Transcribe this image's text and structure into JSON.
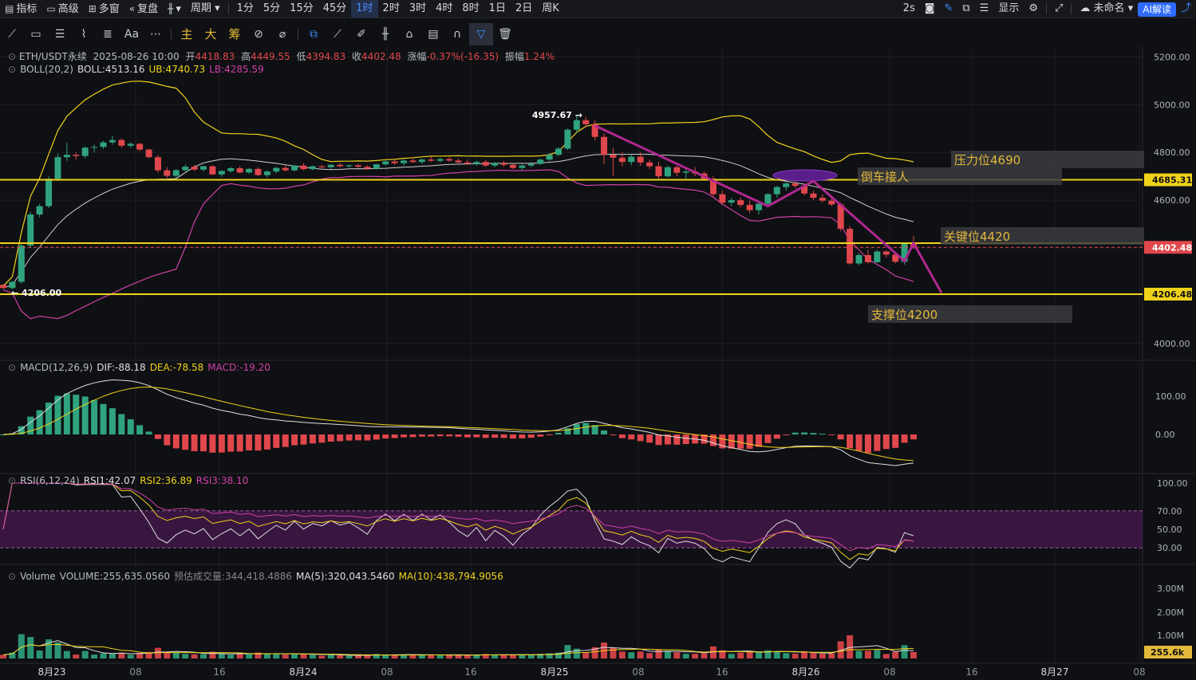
{
  "topbar": {
    "indicator": "指标",
    "advanced": "高级",
    "multi": "多窗",
    "replay": "复盘",
    "period_label": "周期",
    "periods": [
      "1分",
      "5分",
      "15分",
      "45分",
      "1时",
      "2时",
      "3时",
      "4时",
      "8时",
      "1日",
      "2日",
      "周K"
    ],
    "active_period": "1时",
    "refresh": "2s",
    "display": "显示",
    "unnamed": "未命名",
    "ai": "AI解读"
  },
  "toolbar": {
    "main": "主",
    "big": "大",
    "chip": "筹",
    "text_tool": "Aa"
  },
  "header": {
    "symbol": "ETH/USDT永续",
    "datetime": "2025-08-26 10:00",
    "open_label": "开",
    "open": "4418.83",
    "high_label": "高",
    "high": "4449.55",
    "low_label": "低",
    "low": "4394.83",
    "close_label": "收",
    "close": "4402.48",
    "change_label": "涨幅",
    "change": "-0.37%(-16.35)",
    "amp_label": "振幅",
    "amp": "1.24%"
  },
  "boll": {
    "name": "BOLL(20,2)",
    "mid": "BOLL:4513.16",
    "ub": "UB:4740.73",
    "lb": "LB:4285.59"
  },
  "macd": {
    "name": "MACD(12,26,9)",
    "dif": "DIF:-88.18",
    "dea": "DEA:-78.58",
    "macd": "MACD:-19.20"
  },
  "rsi": {
    "name": "RSI(6,12,24)",
    "r1": "RSI1:42.07",
    "r2": "RSI2:36.89",
    "r3": "RSI3:38.10"
  },
  "vol": {
    "name": "Volume",
    "vol": "VOLUME:255,635.0560",
    "pred": "预估成交量:344,418.4886",
    "ma5": "MA(5):320,043.5460",
    "ma10": "MA(10):438,794.9056"
  },
  "annotations": {
    "resistance": "压力位4690",
    "pullback": "倒车接人",
    "key": "关键位4420",
    "support": "支撑位4200",
    "high_mark": "4957.67",
    "low_mark": "4206.00"
  },
  "colors": {
    "up": "#2fa37e",
    "down": "#e0474c",
    "yellow": "#f0d21a",
    "purple": "#b0288f",
    "bg": "#0f1013"
  },
  "chart_data": {
    "type": "candlestick",
    "symbol": "ETH/USDT",
    "interval": "1h",
    "price_axis": {
      "ticks": [
        4000,
        4200,
        4400,
        4600,
        4800,
        5000,
        5200
      ],
      "tick_labels": [
        "4000.00",
        "4200.00",
        "4400.00",
        "4600.00",
        "4800.00",
        "5000.00",
        "5200.00"
      ]
    },
    "price_tags": {
      "resistance_line": "4685.31",
      "last": "4402.48",
      "support_line": "4206.48"
    },
    "horizontal_lines": [
      4685.31,
      4420,
      4206.48
    ],
    "x_ticks": [
      "8月23",
      "08",
      "16",
      "8月24",
      "08",
      "16",
      "8月25",
      "08",
      "16",
      "8月26",
      "08",
      "16",
      "8月27",
      "08"
    ],
    "candles": [
      [
        4245,
        4248,
        4230,
        4232
      ],
      [
        4232,
        4262,
        4226,
        4258
      ],
      [
        4258,
        4420,
        4250,
        4410
      ],
      [
        4410,
        4552,
        4400,
        4540
      ],
      [
        4540,
        4585,
        4528,
        4575
      ],
      [
        4575,
        4700,
        4566,
        4690
      ],
      [
        4690,
        4795,
        4680,
        4780
      ],
      [
        4780,
        4840,
        4765,
        4790
      ],
      [
        4790,
        4800,
        4770,
        4785
      ],
      [
        4785,
        4825,
        4775,
        4820
      ],
      [
        4820,
        4832,
        4800,
        4823
      ],
      [
        4823,
        4848,
        4815,
        4842
      ],
      [
        4842,
        4870,
        4832,
        4852
      ],
      [
        4852,
        4858,
        4820,
        4828
      ],
      [
        4828,
        4842,
        4818,
        4836
      ],
      [
        4836,
        4840,
        4805,
        4812
      ],
      [
        4812,
        4815,
        4775,
        4780
      ],
      [
        4780,
        4790,
        4715,
        4725
      ],
      [
        4725,
        4738,
        4693,
        4702
      ],
      [
        4702,
        4730,
        4690,
        4726
      ],
      [
        4726,
        4750,
        4720,
        4740
      ],
      [
        4740,
        4748,
        4722,
        4728
      ],
      [
        4728,
        4745,
        4720,
        4742
      ],
      [
        4742,
        4746,
        4705,
        4708
      ],
      [
        4708,
        4726,
        4698,
        4722
      ],
      [
        4722,
        4738,
        4716,
        4734
      ],
      [
        4734,
        4742,
        4712,
        4716
      ],
      [
        4716,
        4735,
        4710,
        4731
      ],
      [
        4731,
        4738,
        4700,
        4705
      ],
      [
        4705,
        4726,
        4695,
        4720
      ],
      [
        4720,
        4740,
        4712,
        4735
      ],
      [
        4735,
        4745,
        4720,
        4725
      ],
      [
        4725,
        4748,
        4720,
        4745
      ],
      [
        4745,
        4755,
        4725,
        4730
      ],
      [
        4730,
        4746,
        4725,
        4742
      ],
      [
        4742,
        4748,
        4732,
        4738
      ],
      [
        4738,
        4752,
        4730,
        4748
      ],
      [
        4748,
        4756,
        4738,
        4742
      ],
      [
        4742,
        4750,
        4735,
        4746
      ],
      [
        4746,
        4752,
        4735,
        4740
      ],
      [
        4740,
        4746,
        4728,
        4732
      ],
      [
        4732,
        4752,
        4728,
        4750
      ],
      [
        4750,
        4768,
        4745,
        4762
      ],
      [
        4762,
        4772,
        4748,
        4755
      ],
      [
        4755,
        4770,
        4745,
        4766
      ],
      [
        4766,
        4778,
        4755,
        4760
      ],
      [
        4760,
        4775,
        4752,
        4770
      ],
      [
        4770,
        4782,
        4760,
        4765
      ],
      [
        4765,
        4778,
        4758,
        4772
      ],
      [
        4772,
        4780,
        4760,
        4766
      ],
      [
        4766,
        4775,
        4755,
        4758
      ],
      [
        4758,
        4770,
        4748,
        4752
      ],
      [
        4752,
        4765,
        4745,
        4760
      ],
      [
        4760,
        4768,
        4740,
        4745
      ],
      [
        4745,
        4760,
        4738,
        4755
      ],
      [
        4755,
        4765,
        4740,
        4748
      ],
      [
        4748,
        4752,
        4730,
        4735
      ],
      [
        4735,
        4750,
        4725,
        4745
      ],
      [
        4745,
        4760,
        4738,
        4752
      ],
      [
        4752,
        4775,
        4748,
        4770
      ],
      [
        4770,
        4798,
        4765,
        4790
      ],
      [
        4790,
        4822,
        4785,
        4816
      ],
      [
        4816,
        4900,
        4810,
        4895
      ],
      [
        4895,
        4958,
        4880,
        4935
      ],
      [
        4935,
        4950,
        4905,
        4918
      ],
      [
        4918,
        4935,
        4850,
        4865
      ],
      [
        4865,
        4880,
        4750,
        4790
      ],
      [
        4790,
        4820,
        4700,
        4778
      ],
      [
        4778,
        4800,
        4740,
        4760
      ],
      [
        4760,
        4792,
        4746,
        4782
      ],
      [
        4782,
        4800,
        4745,
        4758
      ],
      [
        4758,
        4770,
        4730,
        4742
      ],
      [
        4742,
        4760,
        4690,
        4700
      ],
      [
        4700,
        4745,
        4695,
        4738
      ],
      [
        4738,
        4745,
        4700,
        4715
      ],
      [
        4715,
        4730,
        4690,
        4720
      ],
      [
        4720,
        4738,
        4700,
        4712
      ],
      [
        4712,
        4720,
        4685,
        4690
      ],
      [
        4690,
        4700,
        4615,
        4625
      ],
      [
        4625,
        4640,
        4580,
        4590
      ],
      [
        4590,
        4610,
        4575,
        4600
      ],
      [
        4600,
        4612,
        4570,
        4580
      ],
      [
        4580,
        4598,
        4545,
        4558
      ],
      [
        4558,
        4590,
        4540,
        4585
      ],
      [
        4585,
        4630,
        4575,
        4625
      ],
      [
        4625,
        4660,
        4610,
        4655
      ],
      [
        4655,
        4680,
        4640,
        4670
      ],
      [
        4670,
        4688,
        4650,
        4660
      ],
      [
        4660,
        4670,
        4620,
        4628
      ],
      [
        4628,
        4640,
        4600,
        4610
      ],
      [
        4610,
        4625,
        4590,
        4598
      ],
      [
        4598,
        4612,
        4575,
        4582
      ],
      [
        4582,
        4590,
        4470,
        4480
      ],
      [
        4480,
        4492,
        4330,
        4335
      ],
      [
        4335,
        4380,
        4328,
        4370
      ],
      [
        4370,
        4392,
        4335,
        4340
      ],
      [
        4340,
        4392,
        4338,
        4385
      ],
      [
        4385,
        4390,
        4360,
        4372
      ],
      [
        4372,
        4380,
        4335,
        4342
      ],
      [
        4342,
        4420,
        4330,
        4419
      ],
      [
        4419,
        4450,
        4395,
        4402
      ]
    ],
    "annotated_high": 4957.67,
    "annotated_low": 4206.0
  }
}
